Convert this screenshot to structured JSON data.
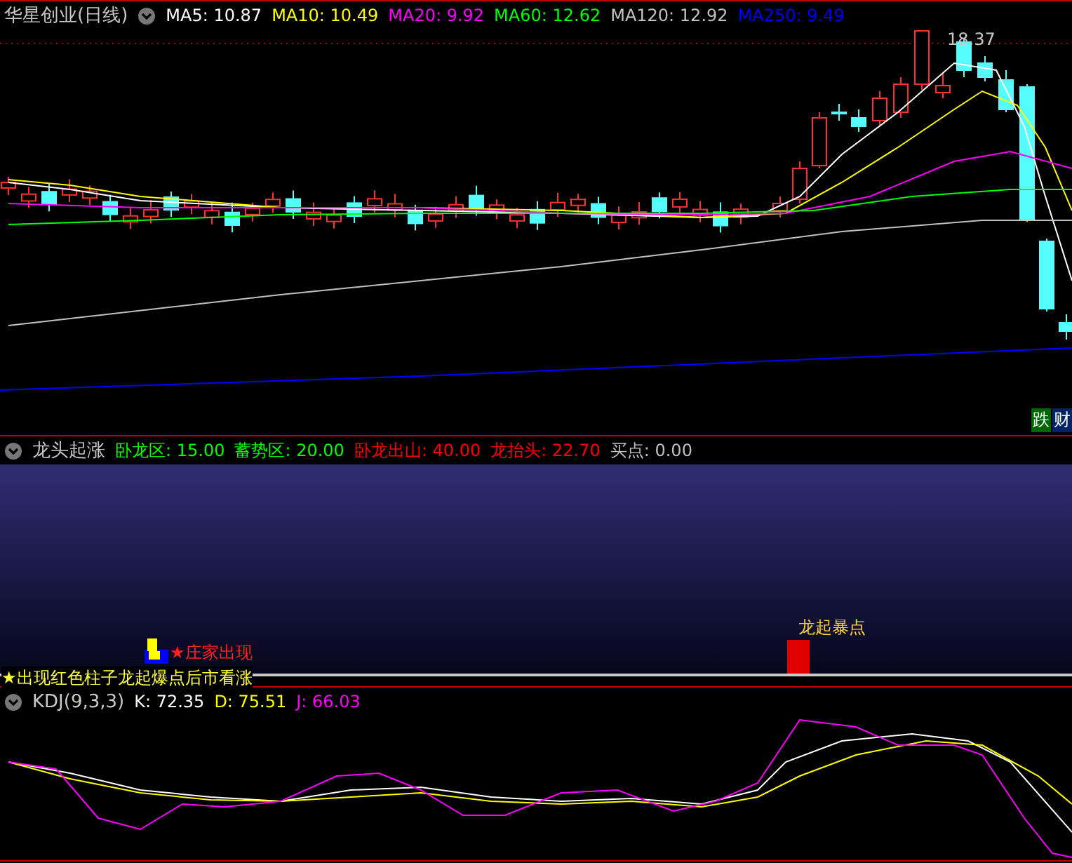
{
  "main_panel": {
    "title": "华星创业(日线)",
    "indicators": [
      {
        "label": "MA5: 10.87",
        "color": "#ffffff"
      },
      {
        "label": "MA10: 10.49",
        "color": "#ffff00"
      },
      {
        "label": "MA20: 9.92",
        "color": "#ff00ff"
      },
      {
        "label": "MA60: 12.62",
        "color": "#00ff00"
      },
      {
        "label": "MA120: 12.92",
        "color": "#c0c0c0"
      },
      {
        "label": "MA250: 9.49",
        "color": "#0000ff"
      }
    ],
    "price_label": "18.37",
    "badges": [
      {
        "text": "跌",
        "color": "#006600"
      },
      {
        "text": "财",
        "color": "#002266"
      }
    ]
  },
  "signal_panel": {
    "title": "龙头起涨",
    "indicators": [
      {
        "label": "卧龙区: 15.00",
        "color": "#00ff00"
      },
      {
        "label": "蓄势区: 20.00",
        "color": "#00ff00"
      },
      {
        "label": "卧龙出山: 40.00",
        "color": "#ff0000"
      },
      {
        "label": "龙抬头: 22.70",
        "color": "#ff0000"
      },
      {
        "label": "买点: 0.00",
        "color": "#c0c0c0"
      }
    ],
    "marker_label": "★庄家出现",
    "burst_label": "龙起暴点",
    "legend": "★出现红色柱子龙起爆点后市看涨"
  },
  "kdj_panel": {
    "title": "KDJ(9,3,3)",
    "indicators": [
      {
        "label": "K: 72.35",
        "color": "#ffffff"
      },
      {
        "label": "D: 75.51",
        "color": "#ffff00"
      },
      {
        "label": "J: 66.03",
        "color": "#ff00ff"
      }
    ]
  }
}
